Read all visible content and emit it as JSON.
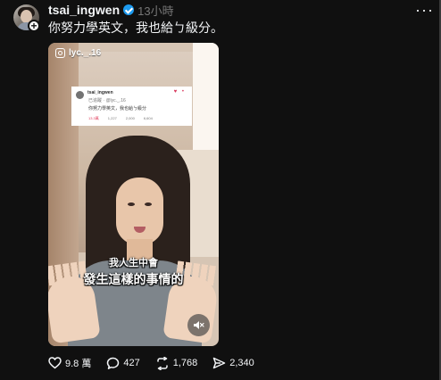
{
  "post": {
    "username": "tsai_ingwen",
    "time": "13小時",
    "caption": "你努力學英文，我也給ㄅ級分。",
    "follow_symbol": "+",
    "more_symbol": "···"
  },
  "video": {
    "source_handle": "lyc._.16",
    "quoted_post": {
      "username": "tsai_ingwen",
      "meta": "已追蹤 · @lyc._.16",
      "text": "你努力學英文，我也給ㄅ級分",
      "likes": "13.3萬",
      "replies": "1,227",
      "reposts": "2,000",
      "shares": "6,604",
      "top_icons": "♥ •"
    },
    "subtitle_line_1": "我人生中會",
    "subtitle_line_2": "發生這樣的事情的",
    "mute_state": "muted"
  },
  "actions": {
    "likes": "9.8 萬",
    "comments": "427",
    "reposts": "1,768",
    "shares": "2,340"
  },
  "colors": {
    "background": "#101010",
    "text": "#f3f5f7",
    "muted_text": "#777777",
    "verified": "#1d9bf0"
  },
  "icons": {
    "verified": "verified-badge-icon",
    "follow": "plus-icon",
    "more": "more-icon",
    "instagram": "instagram-icon",
    "mute": "muted-speaker-icon",
    "like": "heart-icon",
    "comment": "comment-icon",
    "repost": "repost-icon",
    "share": "share-icon"
  }
}
